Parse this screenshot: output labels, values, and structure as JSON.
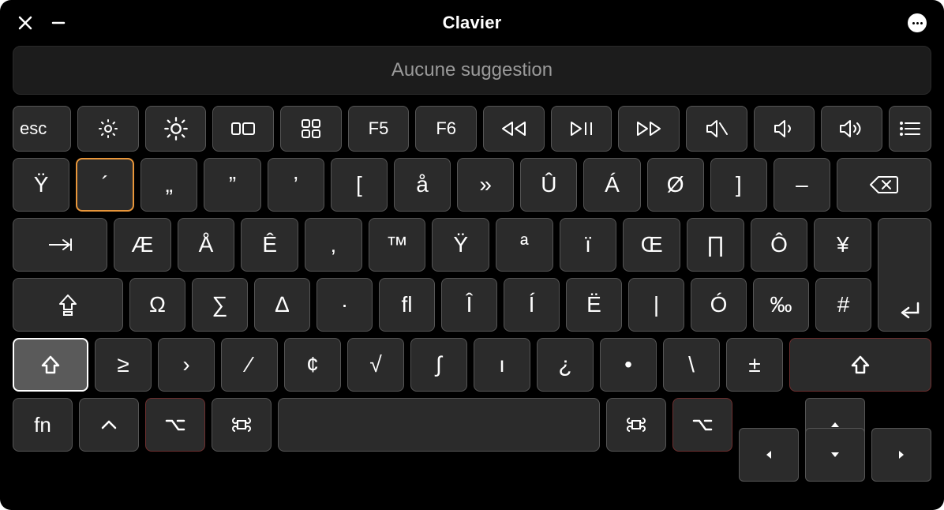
{
  "window": {
    "title": "Clavier"
  },
  "suggestion": {
    "text": "Aucune suggestion"
  },
  "fn_row": {
    "esc": "esc",
    "f5": "F5",
    "f6": "F6"
  },
  "row1": {
    "k0": "Ÿ",
    "k1": "´",
    "k2": "„",
    "k3": "”",
    "k4": "’",
    "k5": "[",
    "k6": "å",
    "k7": "»",
    "k8": "Û",
    "k9": "Á",
    "k10": "Ø",
    "k11": "]",
    "k12": "–"
  },
  "row2": {
    "k0": "Æ",
    "k1": "Å",
    "k2": "Ê",
    "k3": "‚",
    "k4": "™",
    "k5": "Ÿ",
    "k6": "ª",
    "k7": "ï",
    "k8": "Œ",
    "k9": "∏",
    "k10": "Ô",
    "k11": "¥"
  },
  "row3": {
    "k0": "Ω",
    "k1": "∑",
    "k2": "∆",
    "k3": "·",
    "k4": "ﬂ",
    "k5": "Î",
    "k6": "Í",
    "k7": "Ë",
    "k8": "|",
    "k9": "Ó",
    "k10": "‰",
    "k11": "#"
  },
  "row4": {
    "k0": "≥",
    "k1": "›",
    "k2": "⁄",
    "k3": "¢",
    "k4": "√",
    "k5": "∫",
    "k6": "ı",
    "k7": "¿",
    "k8": "•",
    "k9": "\\",
    "k10": "±"
  },
  "row5": {
    "fn": "fn"
  }
}
